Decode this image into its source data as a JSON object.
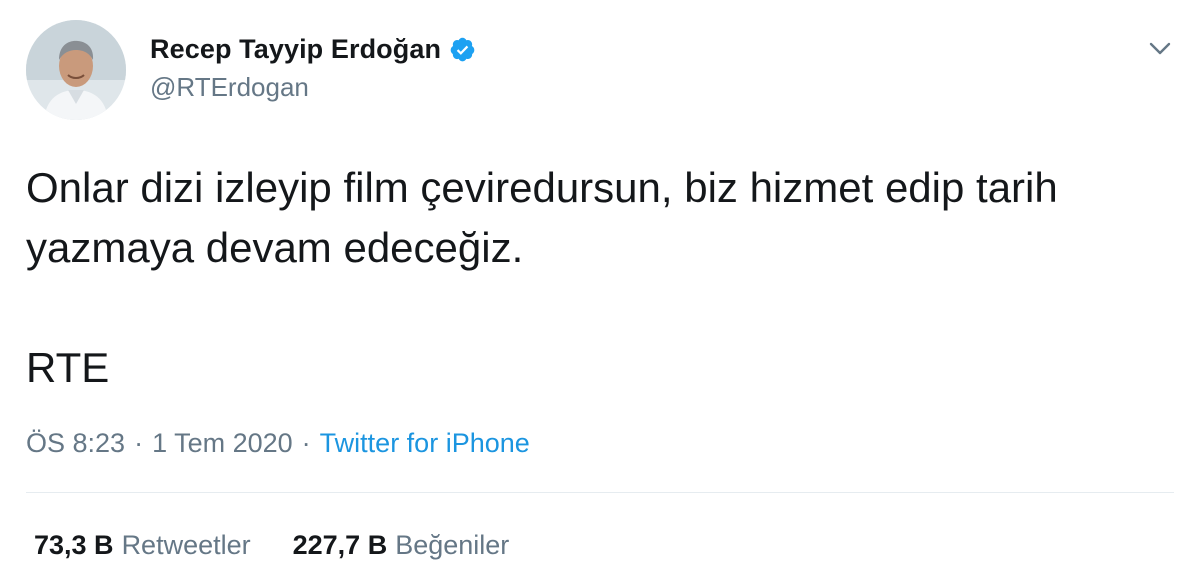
{
  "author": {
    "display_name": "Recep Tayyip Erdoğan",
    "handle": "@RTErdogan",
    "verified": true,
    "verified_icon": "verified-badge-icon"
  },
  "tweet": {
    "text": "Onlar dizi izleyip film çeviredursun, biz hizmet edip tarih\nyazmaya devam edeceğiz.",
    "signature": "RTE"
  },
  "meta": {
    "time": "ÖS 8:23",
    "separator": "·",
    "date": "1 Tem 2020",
    "source": "Twitter for iPhone"
  },
  "stats": {
    "retweets_count": "73,3 B",
    "retweets_label": "Retweetler",
    "likes_count": "227,7 B",
    "likes_label": "Beğeniler"
  },
  "colors": {
    "text": "#14171a",
    "secondary": "#657786",
    "link": "#1b95e0",
    "verified": "#1da1f2",
    "divider": "#e6ecf0"
  }
}
